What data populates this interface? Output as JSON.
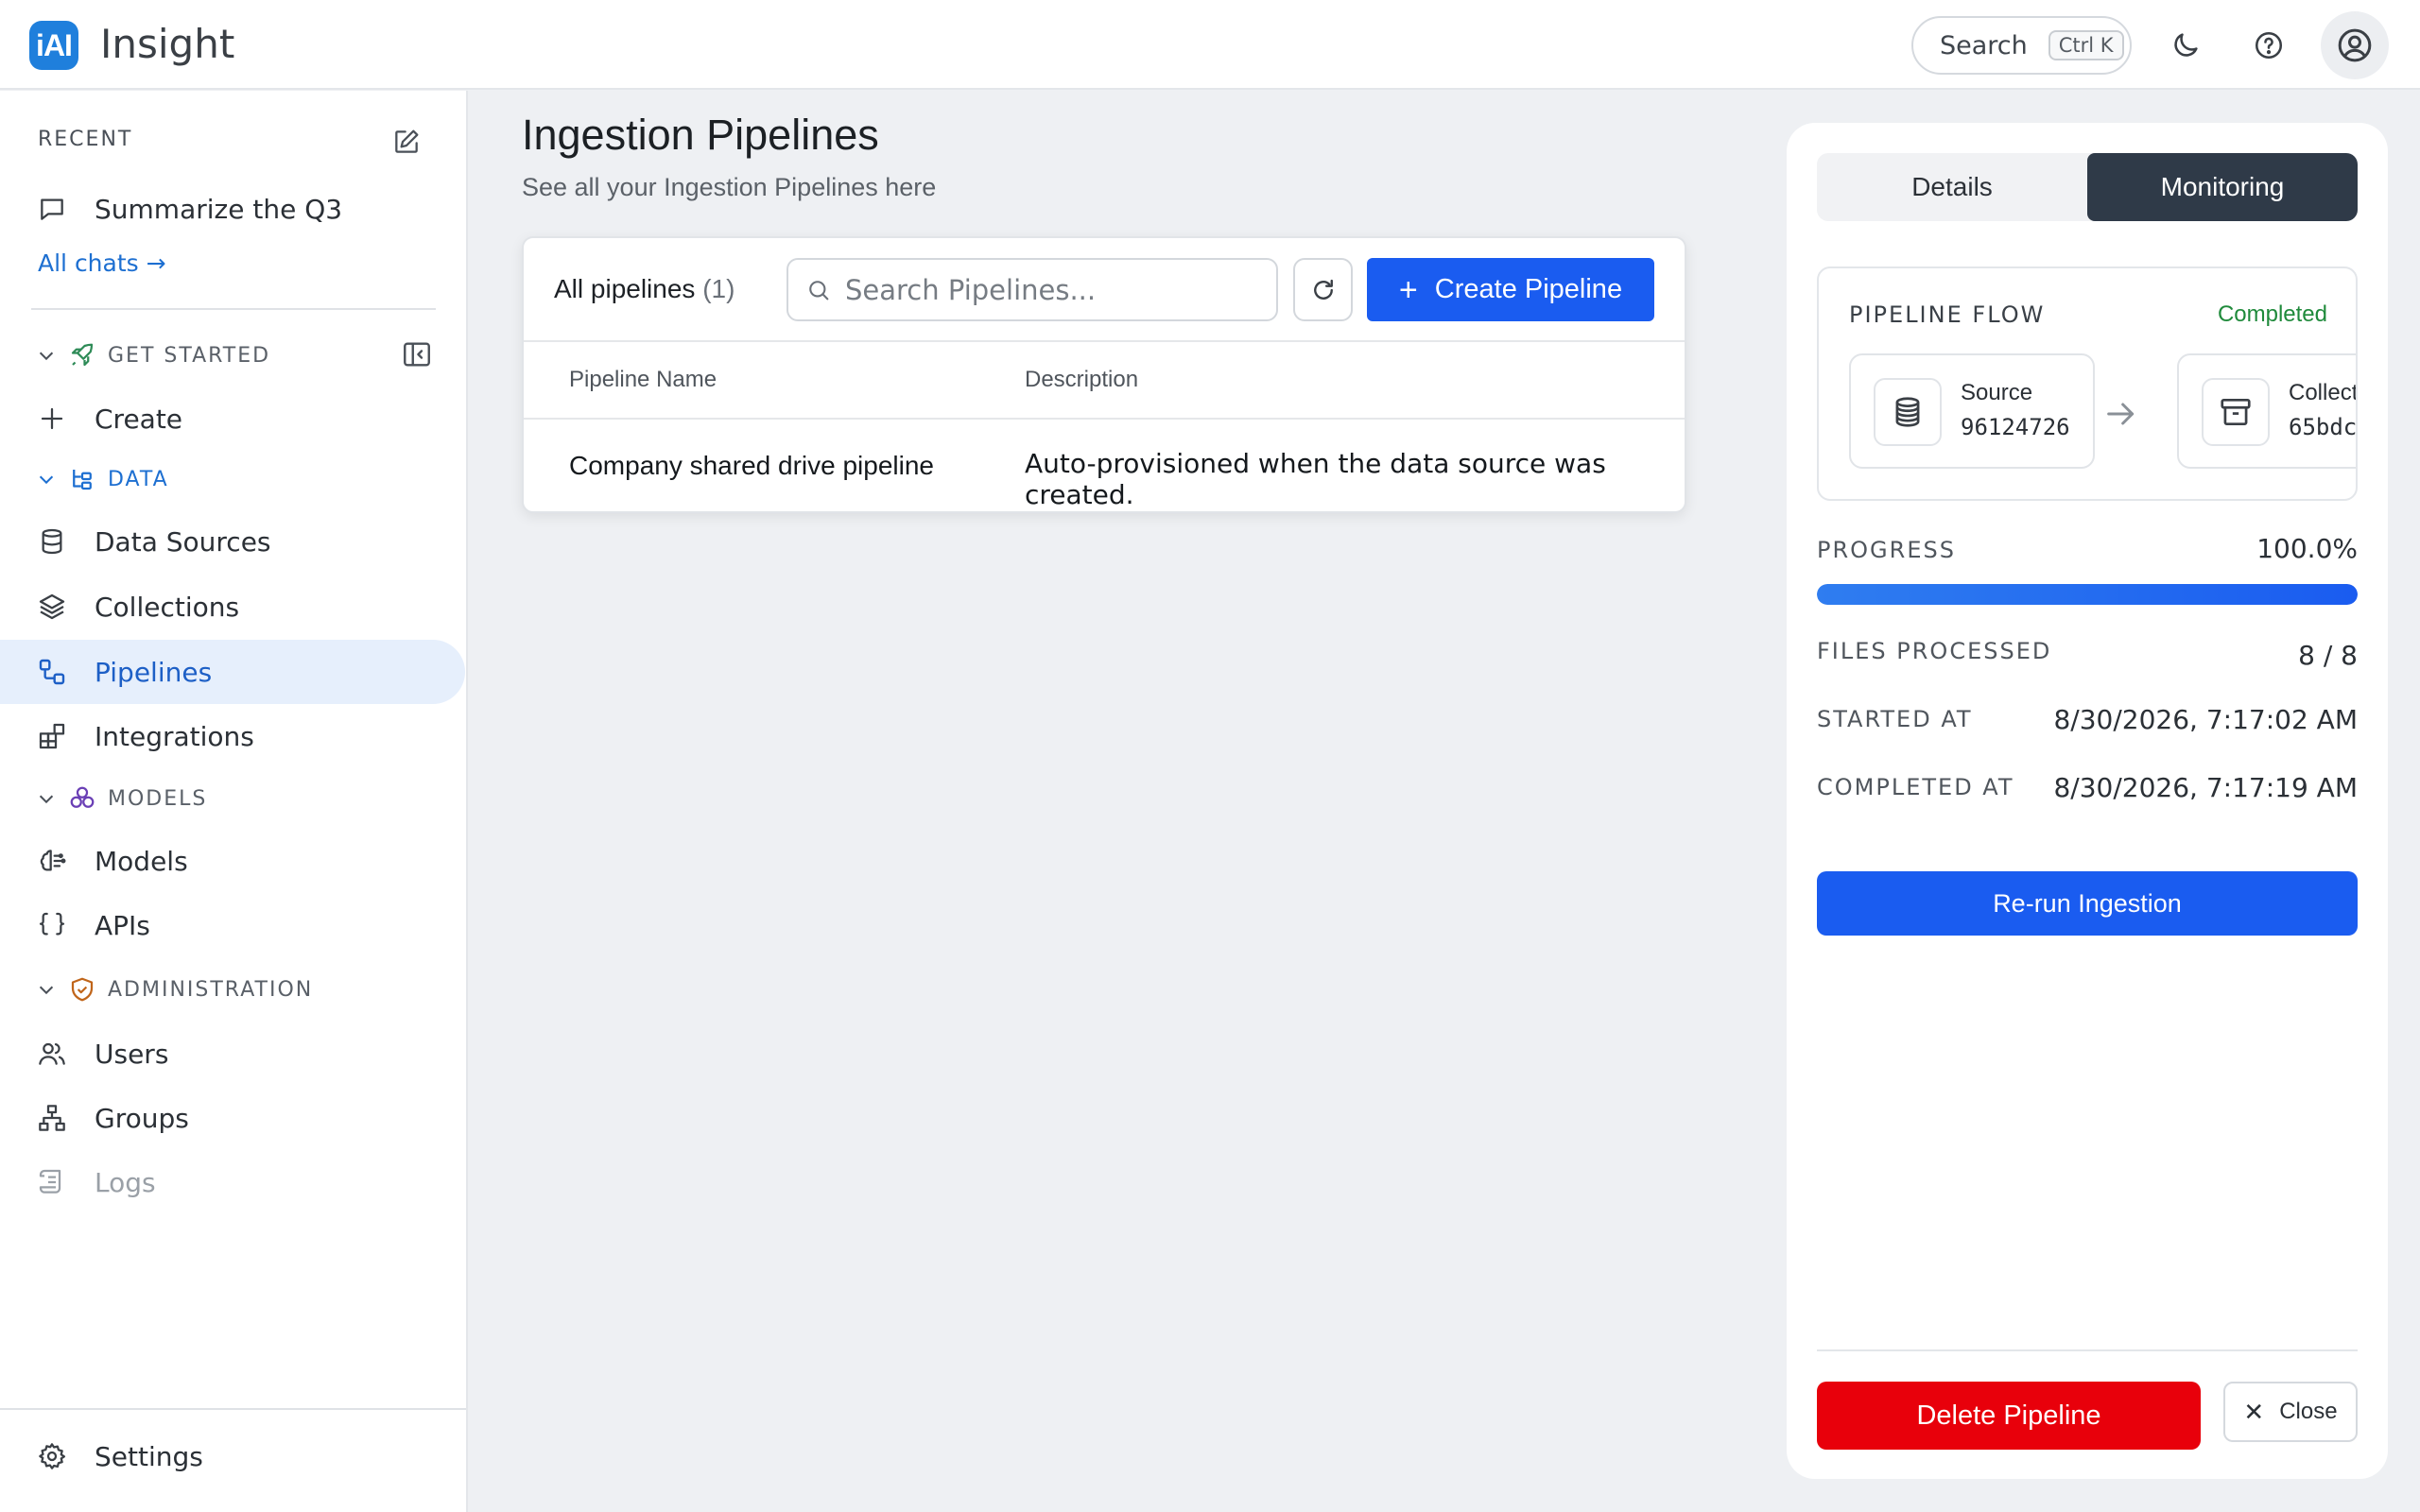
{
  "app": {
    "logo_text": "iAI",
    "name": "Insight"
  },
  "topbar": {
    "search_label": "Search",
    "search_shortcut": "Ctrl K"
  },
  "sidebar": {
    "recent_heading": "RECENT",
    "recent_chat": "Summarize the Q3",
    "all_chats_link": "All chats →",
    "sections": {
      "get_started": "GET STARTED",
      "data": "DATA",
      "models": "MODELS",
      "administration": "ADMINISTRATION"
    },
    "items": {
      "create": "Create",
      "data_sources": "Data Sources",
      "collections": "Collections",
      "pipelines": "Pipelines",
      "integrations": "Integrations",
      "models": "Models",
      "apis": "APIs",
      "users": "Users",
      "groups": "Groups",
      "logs": "Logs",
      "settings": "Settings"
    },
    "active_item": "Pipelines"
  },
  "main": {
    "title": "Ingestion Pipelines",
    "subtitle": "See all your Ingestion Pipelines here",
    "all_pipelines_label": "All pipelines",
    "pipeline_count": "(1)",
    "search_placeholder": "Search Pipelines...",
    "create_button": "Create Pipeline",
    "columns": [
      "Pipeline Name",
      "Description"
    ],
    "rows": [
      {
        "name": "Company shared drive pipeline",
        "description": "Auto-provisioned when the data source was created."
      }
    ]
  },
  "panel": {
    "tabs": [
      "Details",
      "Monitoring"
    ],
    "selected_tab": "Monitoring",
    "flow_heading": "PIPELINE FLOW",
    "flow_status": "Completed",
    "source_label": "Source",
    "source_id": "96124726",
    "collection_label": "Collect",
    "collection_id": "65bdc",
    "progress_label": "PROGRESS",
    "progress_value": "100.0%",
    "progress_fraction": 1.0,
    "files_label": "FILES PROCESSED",
    "files_value": "8 / 8",
    "started_label": "STARTED AT",
    "started_value": "8/30/2026, 7:17:02 AM",
    "completed_label": "COMPLETED AT",
    "completed_value": "8/30/2026, 7:17:19 AM",
    "rerun_button": "Re-run Ingestion",
    "delete_button": "Delete Pipeline",
    "close_button": "Close"
  },
  "colors": {
    "primary": "#1a5cf0",
    "danger": "#e8000b",
    "success": "#1f8a3b",
    "active_nav_bg": "#e6effc",
    "tab_selected": "#2f3a48"
  }
}
